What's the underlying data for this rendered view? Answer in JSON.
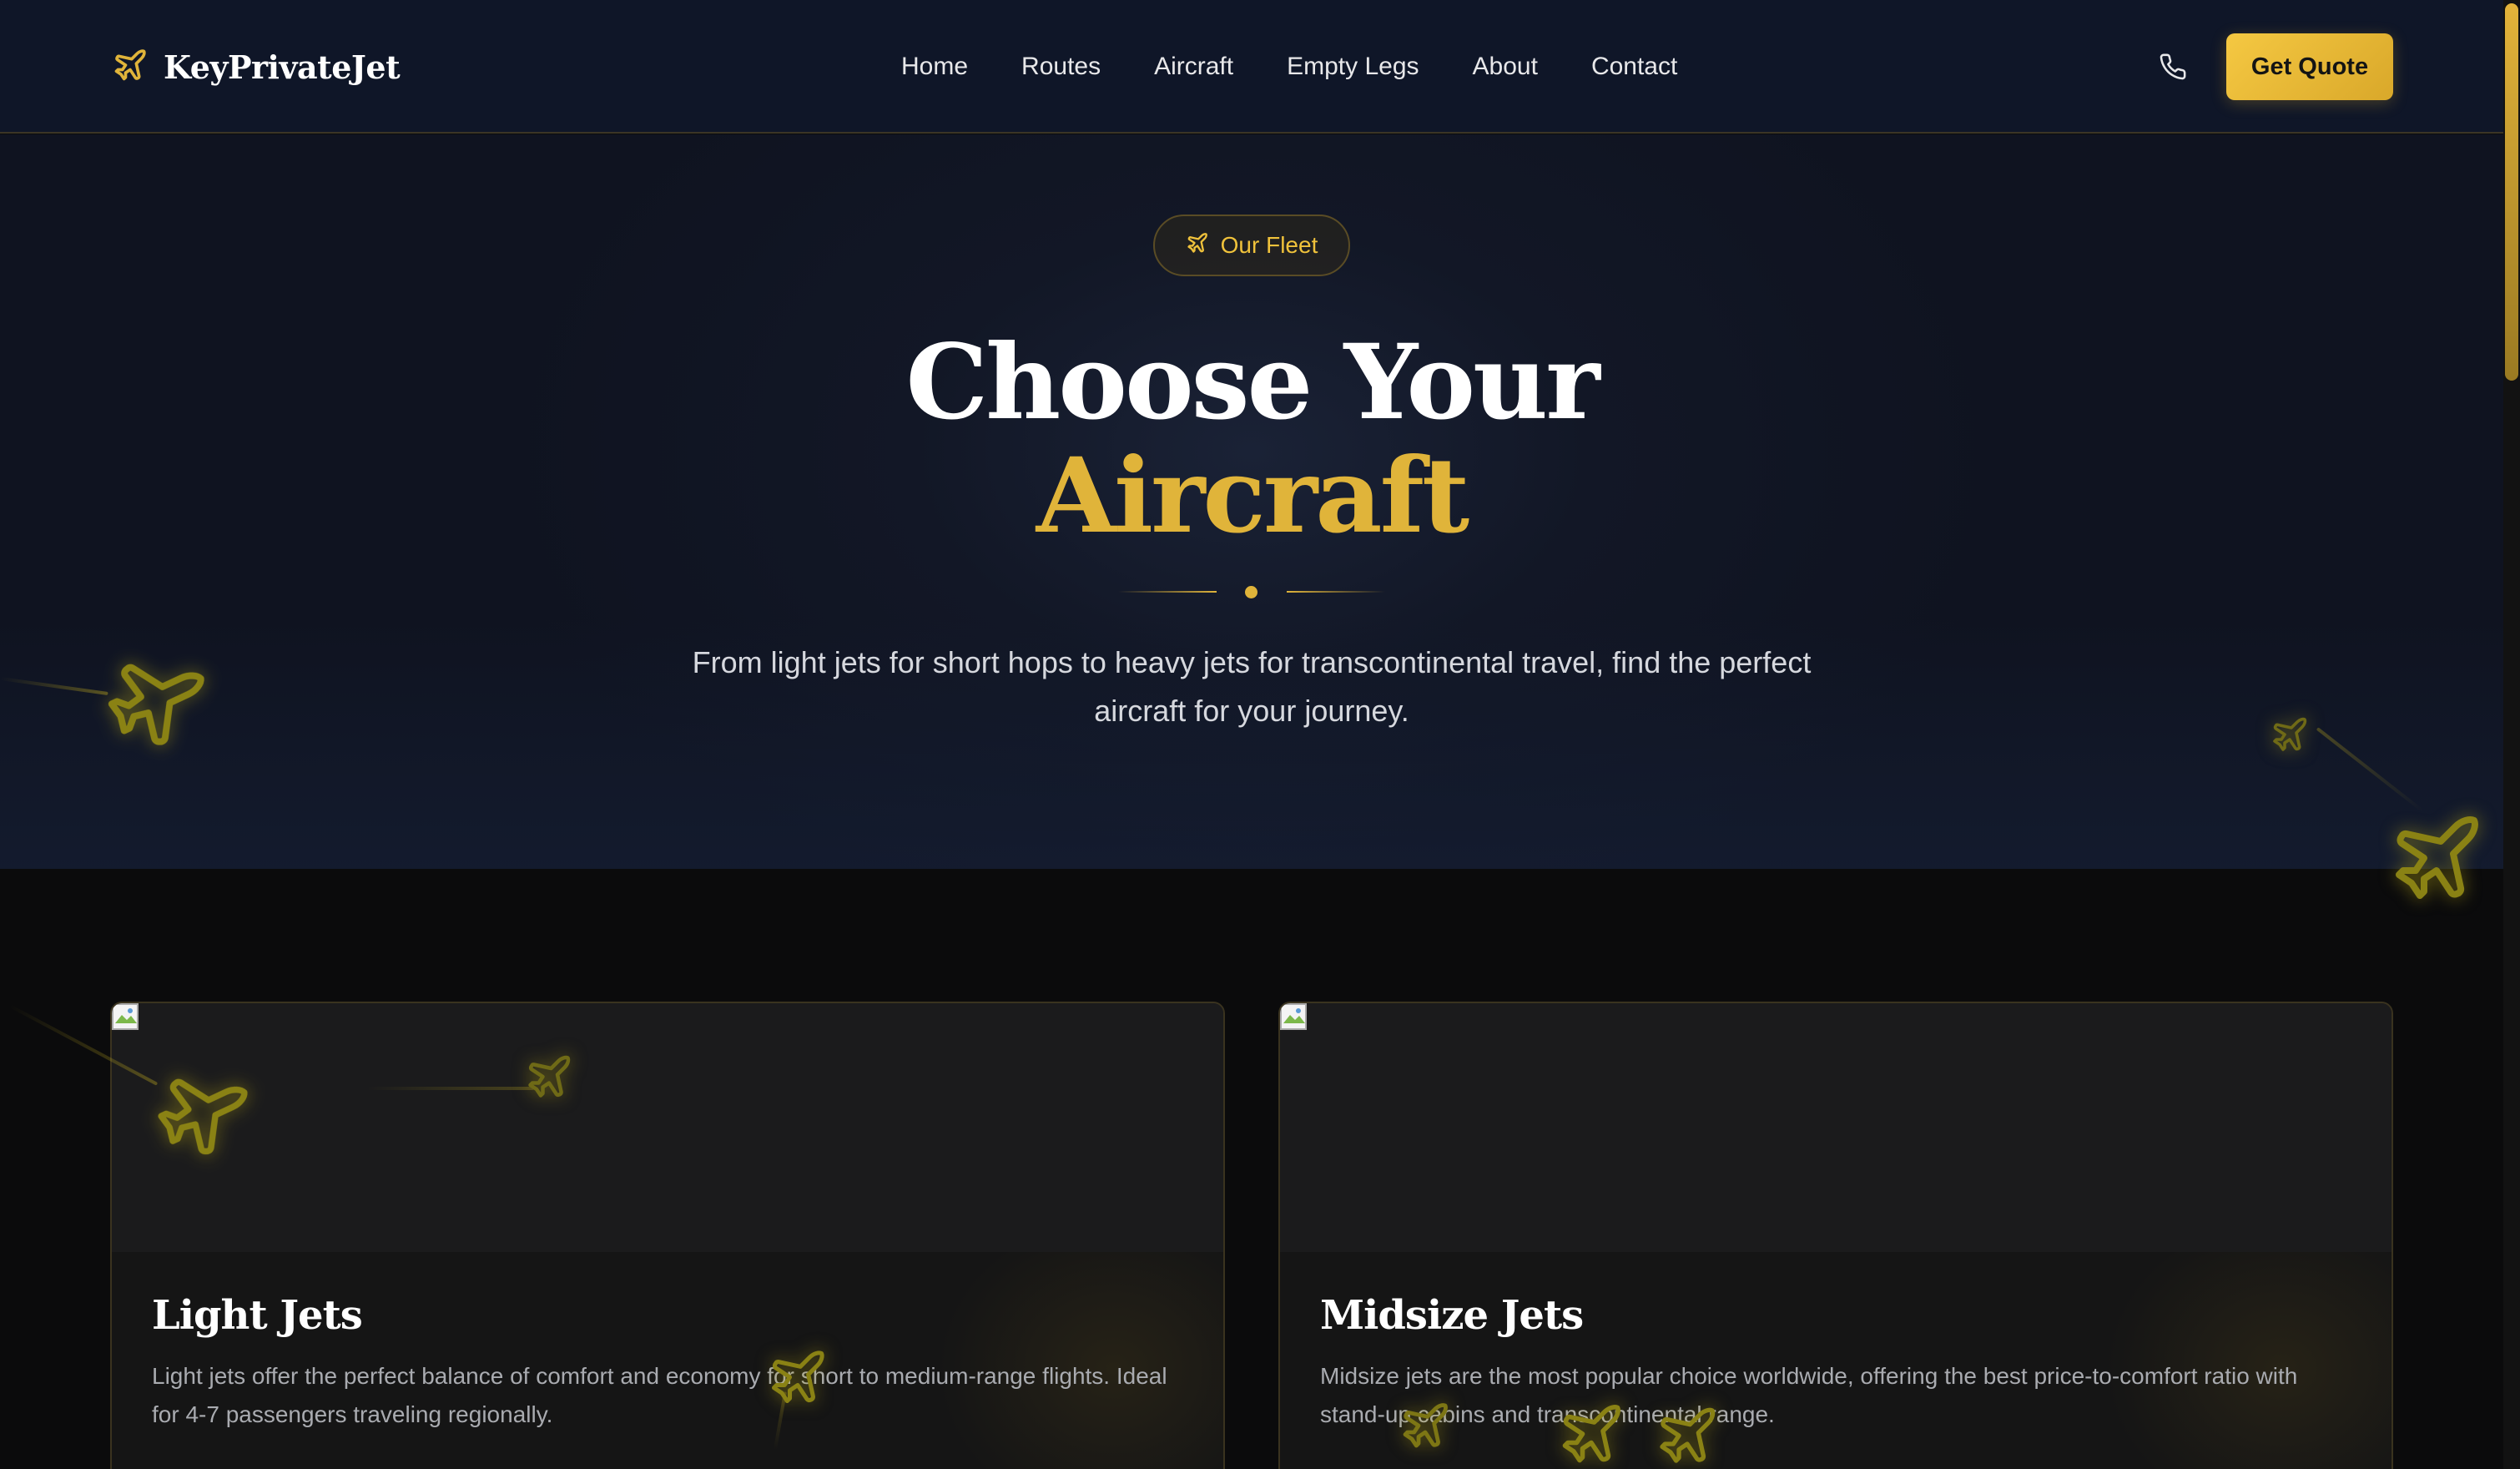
{
  "brand": {
    "name": "KeyPrivateJet",
    "icon": "plane-icon"
  },
  "nav": {
    "links": [
      {
        "label": "Home"
      },
      {
        "label": "Routes"
      },
      {
        "label": "Aircraft"
      },
      {
        "label": "Empty Legs"
      },
      {
        "label": "About"
      },
      {
        "label": "Contact"
      }
    ],
    "phone_icon": "phone-icon",
    "cta_label": "Get Quote"
  },
  "hero": {
    "badge_label": "Our Fleet",
    "badge_icon": "plane-icon",
    "title_line1": "Choose Your",
    "title_line2": "Aircraft",
    "subtitle": "From light jets for short hops to heavy jets for transcontinental travel, find the perfect aircraft for your journey."
  },
  "cards": [
    {
      "title": "Light Jets",
      "description": "Light jets offer the perfect balance of comfort and economy for short to medium-range flights. Ideal for 4-7 passengers traveling regionally."
    },
    {
      "title": "Midsize Jets",
      "description": "Midsize jets are the most popular choice worldwide, offering the best price-to-comfort ratio with stand-up cabins and transcontinental range."
    }
  ],
  "colors": {
    "gold": "#e0b43a",
    "nav_bg": "#0f1628",
    "page_bg": "#0b0b0c",
    "cta_gradient_start": "#f5c842",
    "cta_gradient_end": "#d9a82a"
  }
}
